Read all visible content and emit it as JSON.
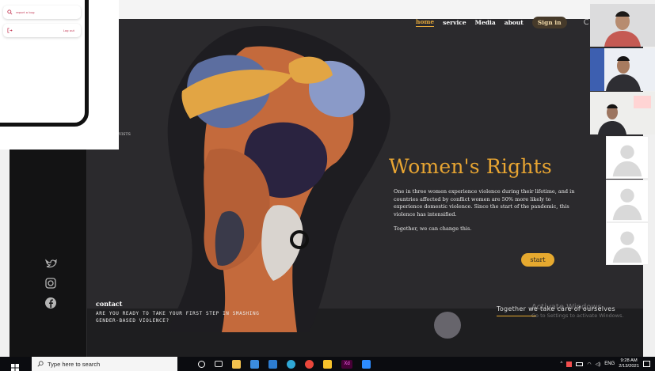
{
  "phone": {
    "items": [
      {
        "label": "report a bug",
        "icon": "search-icon"
      },
      {
        "label": "",
        "right_label": "Log out",
        "icon": "logout-icon"
      }
    ]
  },
  "site": {
    "nav": {
      "items": [
        "home",
        "service",
        "Media",
        "about"
      ],
      "active": "home",
      "signin": "Sign in"
    },
    "rail_tag": "WE ARE ALL ACTIVISTS",
    "hero": {
      "title": "Women's Rights",
      "body": "One in three women experience violence during their lifetime, and in countries affected by conflict women are 50% more likely to experience domestic violence. Since the start of the pandemic, this violence has intensified.",
      "body2": "Together, we can change this.",
      "start": "start"
    },
    "social": [
      "twitter-icon",
      "instagram-icon",
      "facebook-icon"
    ],
    "footer": {
      "contact_title": "contact",
      "question": "ARE YOU READY TO TAKE YOUR FIRST STEP IN SMASHING GENDER-BASED VIOLENCE?",
      "together": "Together we take care of ourselves"
    },
    "accent": "#e6a92f"
  },
  "watermark": {
    "line1": "Activate Windows",
    "line2": "Go to Settings to activate Windows."
  },
  "taskbar": {
    "search_placeholder": "Type here to search",
    "lang": "ENG",
    "time": "9:28 AM",
    "date": "2/13/2021"
  }
}
